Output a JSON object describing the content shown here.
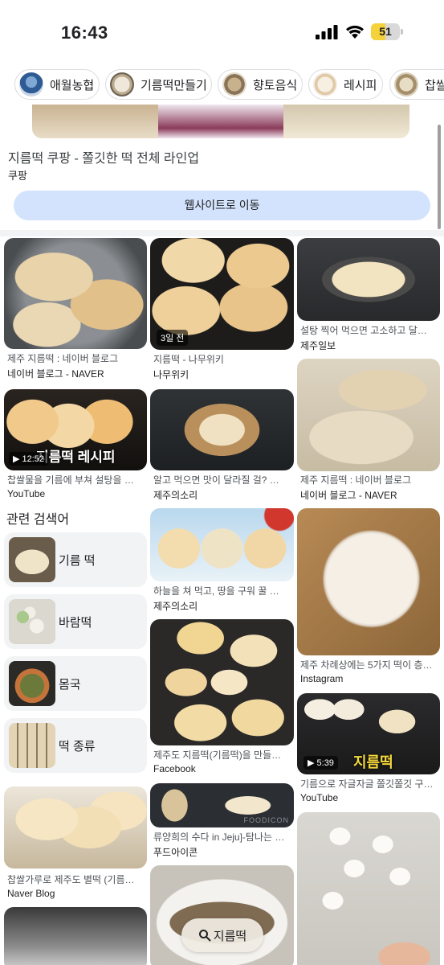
{
  "status": {
    "time": "16:43",
    "battery": "51",
    "battery_level": 0.51
  },
  "chips": [
    {
      "label": "애월농협"
    },
    {
      "label": "기름떡만들기"
    },
    {
      "label": "향토음식"
    },
    {
      "label": "레시피"
    },
    {
      "label": "찹쌀"
    }
  ],
  "ad": {
    "title": "지름떡 쿠팡 - 쫄깃한 떡 전체 라인업",
    "source": "쿠팡",
    "button": "웹사이트로 이동"
  },
  "results": [
    {
      "caption": "제주 지름떡 : 네이버 블로그",
      "source": "네이버 블로그 - NAVER"
    },
    {
      "caption": "지름떡 - 나무위키",
      "source": "나무위키",
      "badge": "3일 전"
    },
    {
      "caption": "설탕 찍어 먹으면 고소하고 달…",
      "source": "제주일보"
    },
    {
      "caption": "찹쌀물을 기름에 부쳐 설탕을 …",
      "source": "YouTube",
      "duration": "12:52",
      "overlay_text": "지름떡 레시피"
    },
    {
      "caption": "알고 먹으면 맛이 달라질 걸? …",
      "source": "제주의소리"
    },
    {
      "caption": "제주 지름떡 : 네이버 블로그",
      "source": "네이버 블로그 - NAVER"
    },
    {
      "caption": "하늘을 쳐 먹고, 땅을 구워 꿀 …",
      "source": "제주의소리"
    },
    {
      "caption": "제주 차례상에는 5가지 떡이 층…",
      "source": "Instagram"
    },
    {
      "caption": "제주도 지름떡(기름떡)을 만들…",
      "source": "Facebook"
    },
    {
      "caption": "기름으로 자글자글 쫄깃쫄깃 구…",
      "source": "YouTube",
      "duration": "5:39",
      "overlay_text": "지름떡"
    },
    {
      "caption": "류양희의 수다 in Jeju]-탐나는 …",
      "source": "푸드아이콘",
      "overlay_text": "FOODICON"
    },
    {
      "caption": "찹쌀가루로 제주도 별떡 (기름…",
      "source": "Naver Blog"
    }
  ],
  "related": {
    "title": "관련 검색어",
    "items": [
      {
        "label": "기름 떡"
      },
      {
        "label": "바람떡"
      },
      {
        "label": "몸국"
      },
      {
        "label": "떡 종류"
      }
    ]
  },
  "search": {
    "query": "지름떡"
  },
  "colors": {
    "button_bg": "#d3e3fd",
    "battery": "#f5d23c",
    "card_bg": "#f1f3f4"
  }
}
